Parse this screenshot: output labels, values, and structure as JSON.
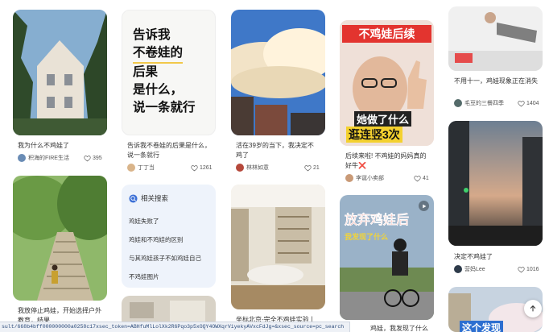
{
  "cards": [
    {
      "title": "我为什么不鸡娃了",
      "author": "积海的FIRE生活",
      "likes": "395"
    },
    {
      "title": "告诉我不卷娃的后果是什么，说一条就行",
      "author": "丁丁当",
      "likes": "1261"
    },
    {
      "title": "活在39岁的当下，我决定不鸡了",
      "author": "林林如意",
      "likes": "21"
    },
    {
      "title": "后续来啦! 不鸡娃的妈妈真的好牛❌",
      "author": "李诞小卖部",
      "likes": "41"
    },
    {
      "title": "不用十一，鸡娃现象正在消失",
      "author": "毛豆的三餐四季",
      "likes": "1404"
    },
    {
      "title": "我放停止鸡娃，开始选择户外教育，结果……",
      "author": "",
      "likes": ""
    },
    {
      "title": "坐标北京-完全不鸡娃实验丨",
      "author": "",
      "likes": ""
    },
    {
      "title": "决定不鸡娃了",
      "author": "营妈Lee",
      "likes": "1016"
    },
    {
      "title": "放弃鸡娃后，我发现了什么",
      "author": "",
      "likes": ""
    }
  ],
  "thumb_texts": {
    "card2_lines": [
      "告诉我",
      "不卷娃的",
      "后果",
      "是什么，",
      "说一条就行"
    ],
    "card4_top": "不鸡娃后续",
    "card4_bottom1": "她做了什么",
    "card4_bottom2": "逛连竖3次",
    "card9_top": "放弃鸡娃后",
    "card9_sub": "我发现了什么",
    "card_br_tag": "这个发现"
  },
  "related": {
    "header": "相关搜索",
    "items": [
      "鸡娃失败了",
      "鸡娃和不鸡娃的区别",
      "与其鸡娃孩子不如鸡娃自己",
      "不鸡娃图片"
    ]
  },
  "status_url": "sult/668b4bff000000000a0258c17xsec_token=ABHfuMlLolXk2R6Pqo3p5xOQY4OWXqrViyekyAVxcFdJg=&xsec_source=pc_search",
  "partial_title_bottom": "鸡娃，我发现了什么丨",
  "colors": {
    "accent": "#ff2442",
    "link": "#2b4a7a",
    "bg": "#ffffff"
  }
}
